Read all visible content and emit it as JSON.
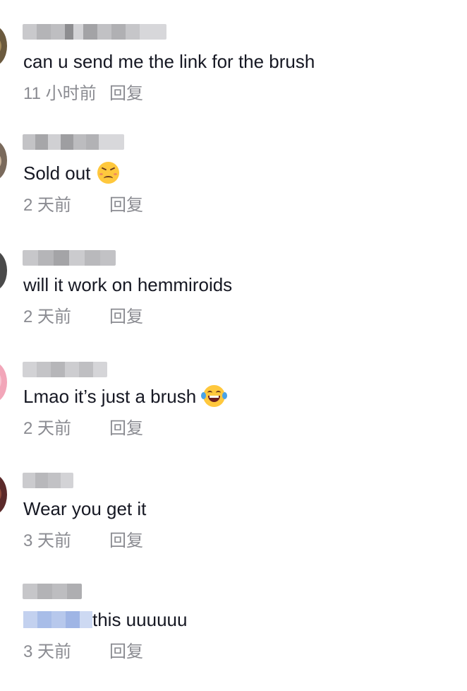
{
  "comments": [
    {
      "text": "can u send me the link for the brush",
      "time": "11 小时前",
      "reply": "回复",
      "avatar_color": "#6b5a3e",
      "username_blurred": true
    },
    {
      "text": "Sold out",
      "emoji": "persevering-face-icon",
      "time": "2 天前",
      "reply": "回复",
      "avatar_color": "#7a6a5c",
      "username_blurred": true
    },
    {
      "text": "will it work on hemmiroids",
      "time": "2 天前",
      "reply": "回复",
      "avatar_color": "#4a4a4a",
      "username_blurred": true
    },
    {
      "text": "Lmao it’s just a brush",
      "emoji": "joy-face-icon",
      "time": "2 天前",
      "reply": "回复",
      "avatar_color": "#f2a6b9",
      "username_blurred": true
    },
    {
      "text": "Wear you get it",
      "time": "3 天前",
      "reply": "回复",
      "avatar_color": "#5b2a2a",
      "username_blurred": true
    },
    {
      "text": "this uuuuuu",
      "time": "3 天前",
      "reply": "回复",
      "avatar_color": "#ffffff",
      "username_blurred": true,
      "mention_blurred": true
    }
  ],
  "colors": {
    "text": "#161823",
    "meta": "#8a8b91",
    "blur_gray": "#a9a9ad",
    "blur_blue": "#a8bde8",
    "emoji_yellow": "#ffc83d"
  }
}
